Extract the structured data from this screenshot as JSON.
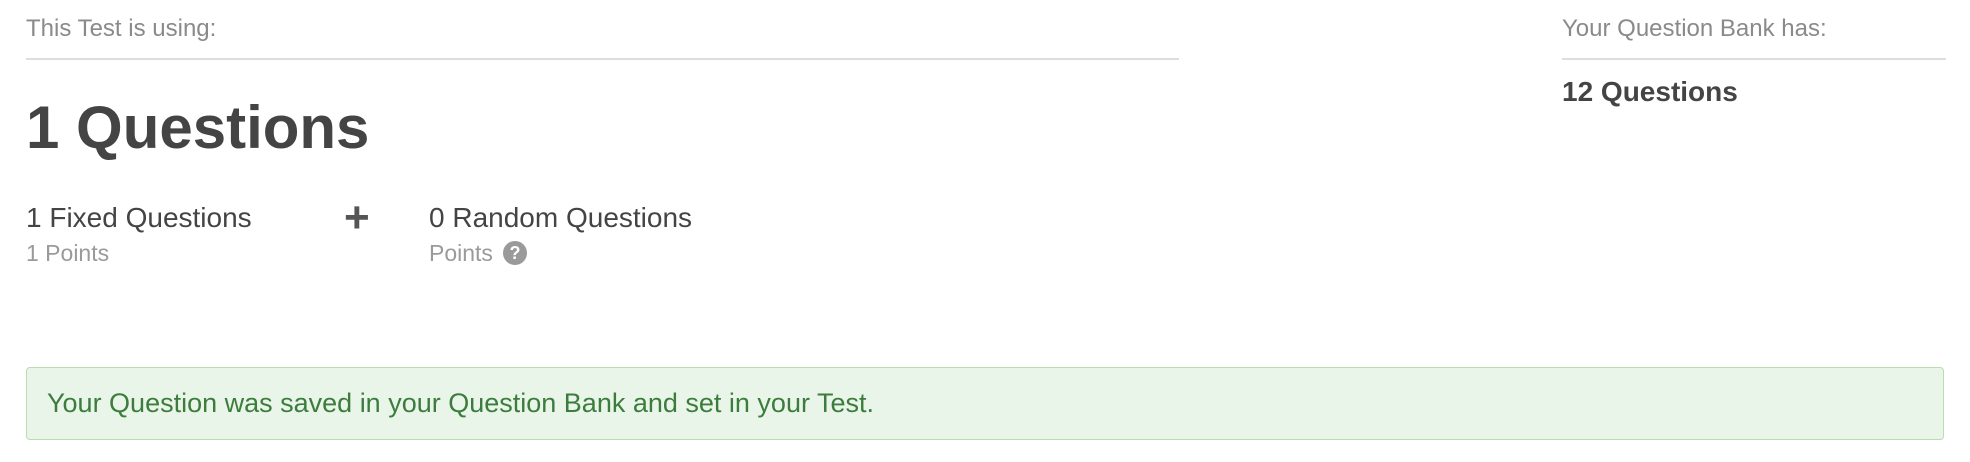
{
  "test_summary": {
    "label": "This Test is using:",
    "total": "1 Questions"
  },
  "breakdown": {
    "fixed": {
      "title": "1 Fixed Questions",
      "points": "1 Points"
    },
    "operator": "+",
    "random": {
      "title": "0 Random Questions",
      "points": "Points",
      "help_icon": "?"
    }
  },
  "bank_summary": {
    "label": "Your Question Bank has:",
    "count": "12 Questions"
  },
  "alert": {
    "type": "success",
    "message": "Your Question was saved in your Question Bank and set in your Test."
  },
  "colors": {
    "success_bg": "#eaf5e9",
    "success_text": "#3c7c3c",
    "muted_text": "#8a8a8a",
    "main_text": "#444444"
  }
}
